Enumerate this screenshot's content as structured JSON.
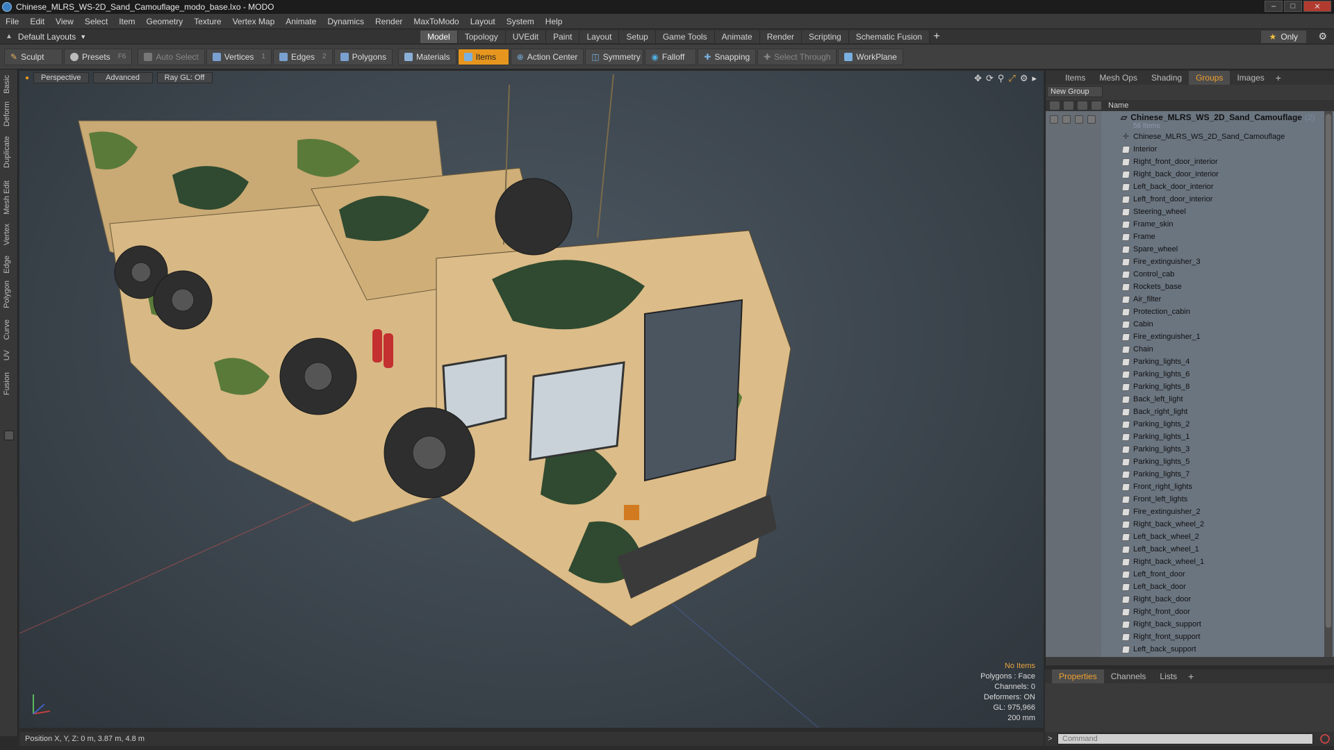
{
  "window": {
    "title": "Chinese_MLRS_WS-2D_Sand_Camouflage_modo_base.lxo - MODO"
  },
  "menu": [
    "File",
    "Edit",
    "View",
    "Select",
    "Item",
    "Geometry",
    "Texture",
    "Vertex Map",
    "Animate",
    "Dynamics",
    "Render",
    "MaxToModo",
    "Layout",
    "System",
    "Help"
  ],
  "layout": {
    "dropdown": "Default Layouts",
    "tabs": [
      "Model",
      "Topology",
      "UVEdit",
      "Paint",
      "Layout",
      "Setup",
      "Game Tools",
      "Animate",
      "Render",
      "Scripting",
      "Schematic Fusion"
    ],
    "active_tab": "Model",
    "only_label": "Only"
  },
  "toolbar": {
    "sculpt": "Sculpt",
    "presets": "Presets",
    "presets_key": "F6",
    "auto_select": "Auto Select",
    "vertices": "Vertices",
    "vertices_key": "1",
    "edges": "Edges",
    "edges_key": "2",
    "polygons": "Polygons",
    "materials": "Materials",
    "items": "Items",
    "action_center": "Action Center",
    "symmetry": "Symmetry",
    "falloff": "Falloff",
    "snapping": "Snapping",
    "select_through": "Select Through",
    "workplane": "WorkPlane"
  },
  "left_tabs": [
    "Basic",
    "Deform",
    "Duplicate",
    "Mesh Edit",
    "Vertex",
    "Edge",
    "Polygon",
    "Curve",
    "UV",
    "Fusion"
  ],
  "viewport": {
    "view": "Perspective",
    "shading": "Advanced",
    "raygl": "Ray GL: Off",
    "stats": [
      "No Items",
      "Polygons : Face",
      "Channels: 0",
      "Deformers: ON",
      "GL: 975,966",
      "200 mm"
    ]
  },
  "right_panel": {
    "tabs": [
      "Items",
      "Mesh Ops",
      "Shading",
      "Groups",
      "Images"
    ],
    "active_tab": "Groups",
    "new_group": "New Group",
    "name_header": "Name",
    "group_name": "Chinese_MLRS_WS_2D_Sand_Camouflage",
    "group_count": "(2)",
    "group_items": "58 Items",
    "items": [
      "Chinese_MLRS_WS_2D_Sand_Camouflage",
      "Interior",
      "Right_front_door_interior",
      "Right_back_door_interior",
      "Left_back_door_interior",
      "Left_front_door_interior",
      "Steering_wheel",
      "Frame_skin",
      "Frame",
      "Spare_wheel",
      "Fire_extinguisher_3",
      "Control_cab",
      "Rockets_base",
      "Air_filter",
      "Protection_cabin",
      "Cabin",
      "Fire_extinguisher_1",
      "Chain",
      "Parking_lights_4",
      "Parking_lights_6",
      "Parking_lights_8",
      "Back_left_light",
      "Back_right_light",
      "Parking_lights_2",
      "Parking_lights_1",
      "Parking_lights_3",
      "Parking_lights_5",
      "Parking_lights_7",
      "Front_right_lights",
      "Front_left_lights",
      "Fire_extinguisher_2",
      "Right_back_wheel_2",
      "Left_back_wheel_2",
      "Left_back_wheel_1",
      "Right_back_wheel_1",
      "Left_front_door",
      "Left_back_door",
      "Right_back_door",
      "Right_front_door",
      "Right_back_support",
      "Right_front_support",
      "Left_back_support"
    ],
    "bottom_tabs": [
      "Properties",
      "Channels",
      "Lists"
    ],
    "bottom_active": "Properties"
  },
  "status": {
    "position": "Position X, Y, Z:  0 m, 3.87 m, 4.8 m",
    "command_placeholder": "Command"
  }
}
